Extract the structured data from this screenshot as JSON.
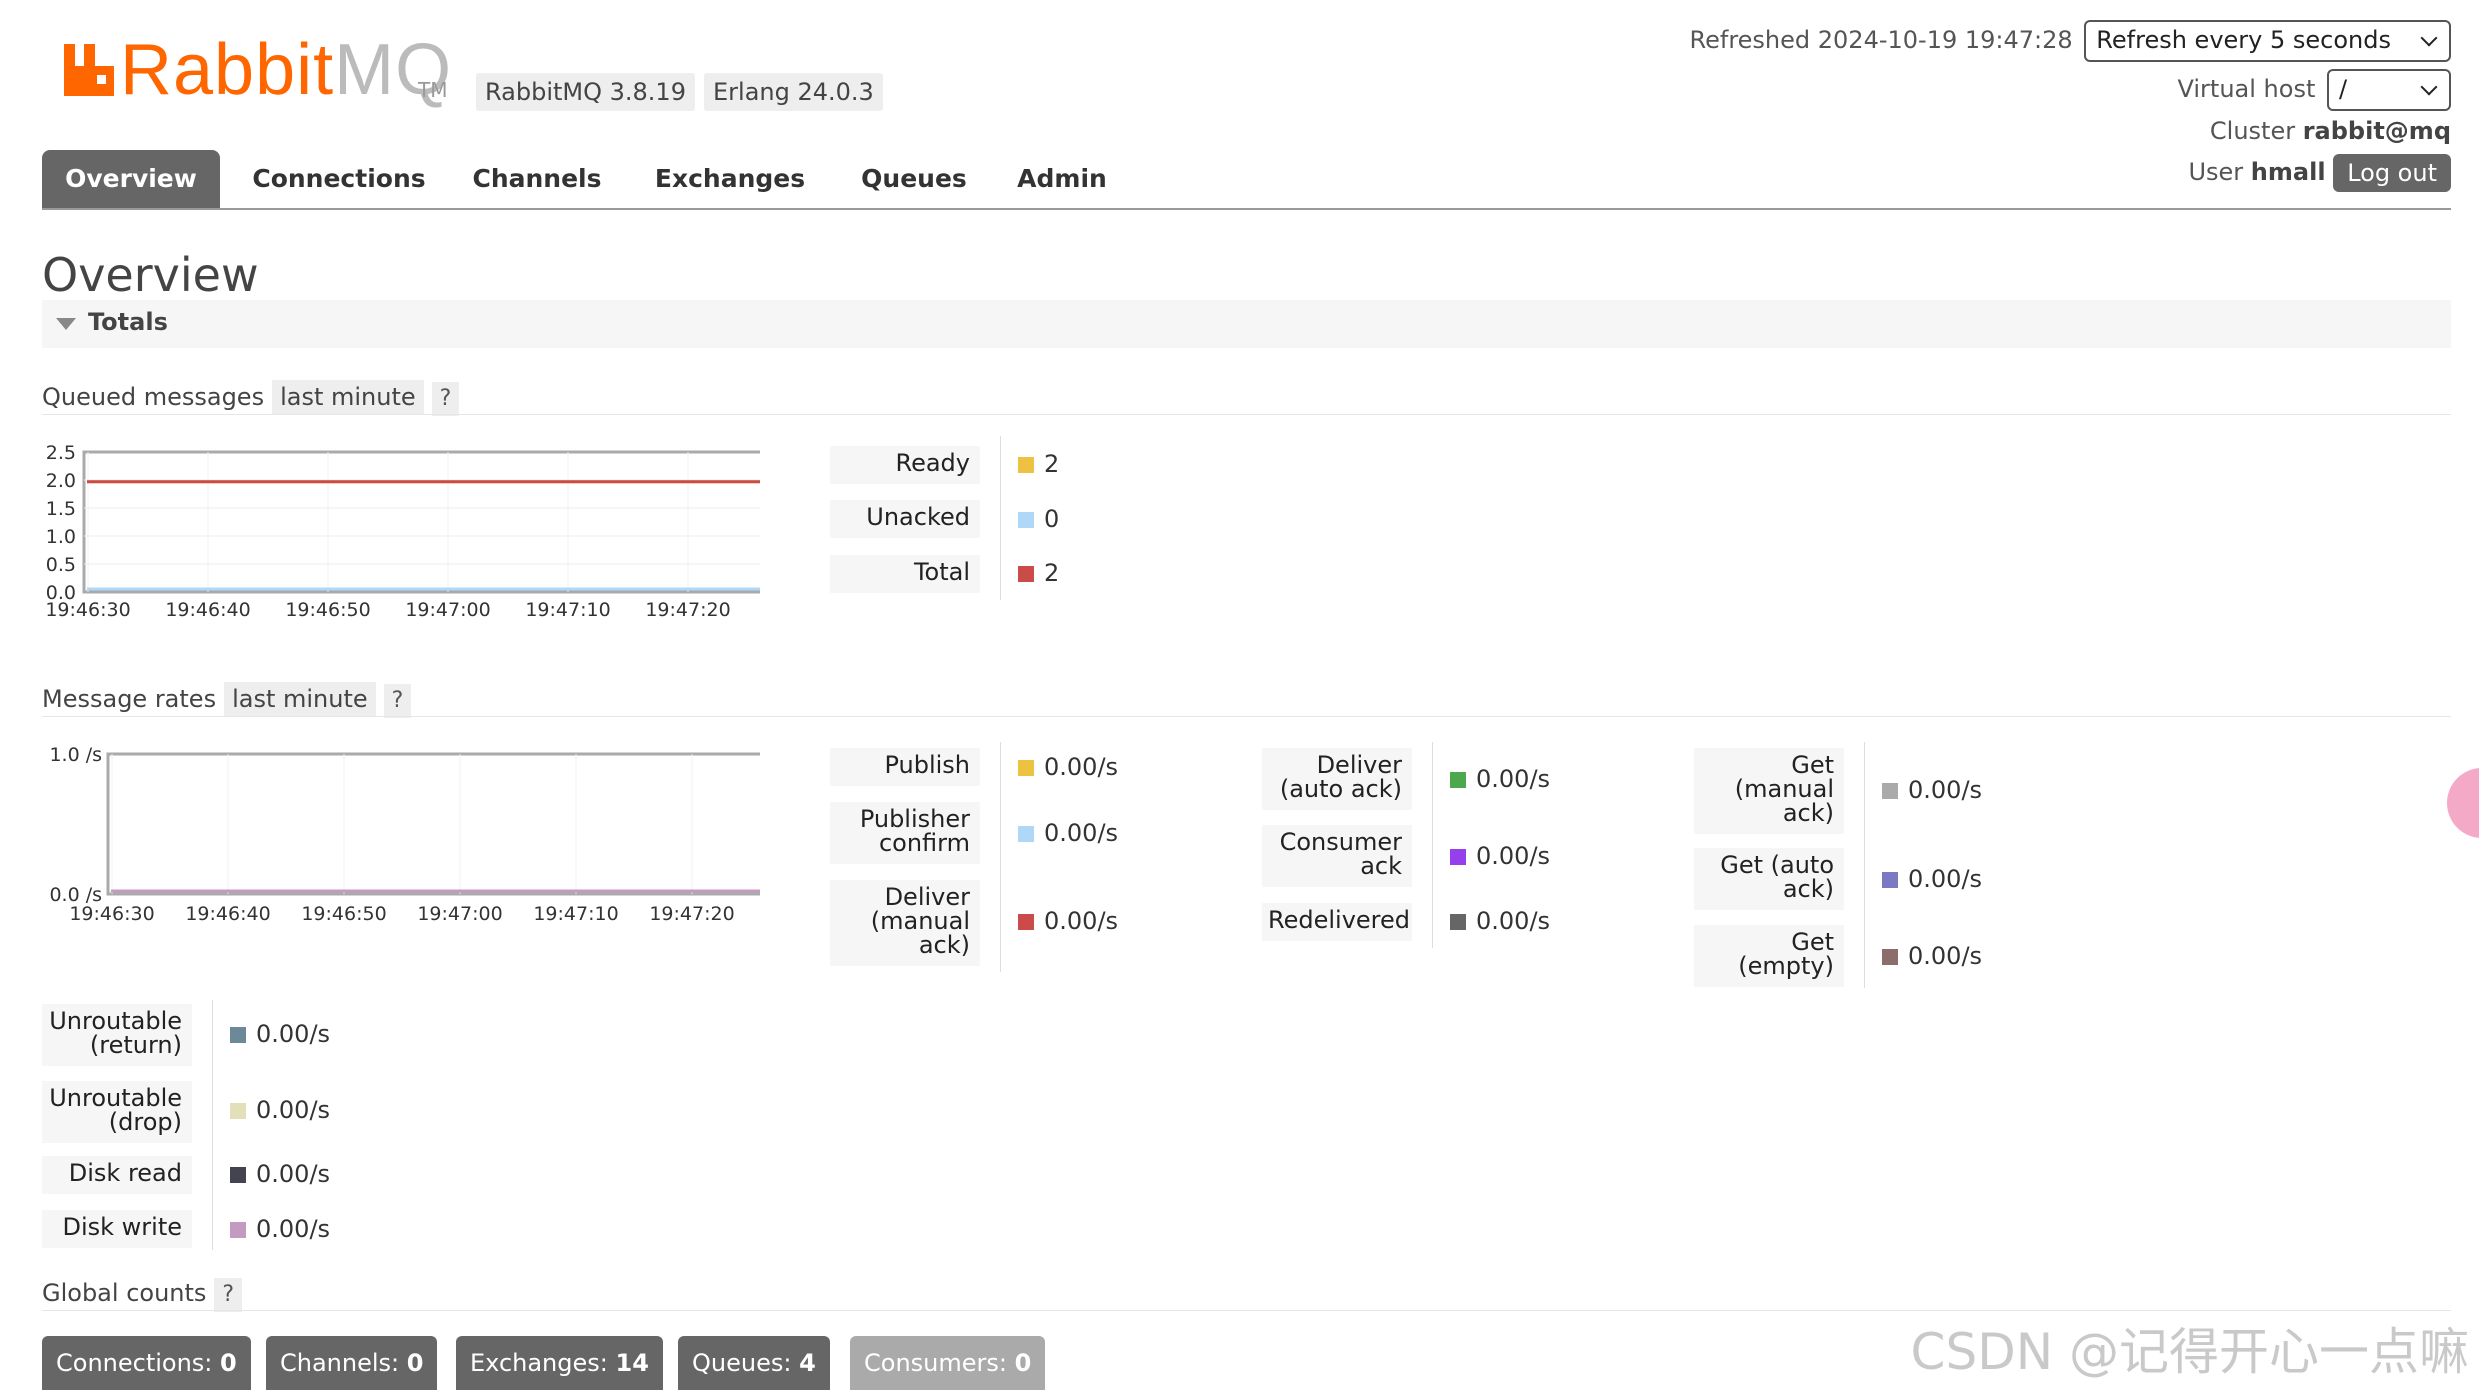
{
  "header": {
    "logo_text_rabbit": "Rabbit",
    "logo_text_mq": "MQ",
    "logo_tm": "TM",
    "rabbitmq_version": "RabbitMQ 3.8.19",
    "erlang_version": "Erlang 24.0.3",
    "refreshed_label": "Refreshed 2024-10-19 19:47:28",
    "refresh_select": "Refresh every 5 seconds",
    "virtual_host_label": "Virtual host",
    "virtual_host_value": "/",
    "cluster_label": "Cluster",
    "cluster_value": "rabbit@mq",
    "user_label": "User",
    "user_value": "hmall",
    "logout_label": "Log out"
  },
  "tabs": [
    "Overview",
    "Connections",
    "Channels",
    "Exchanges",
    "Queues",
    "Admin"
  ],
  "page_title": "Overview",
  "totals_label": "Totals",
  "queued": {
    "title": "Queued messages",
    "range": "last minute",
    "help": "?",
    "legend": [
      {
        "label": "Ready",
        "value": "2",
        "color": "#edc240"
      },
      {
        "label": "Unacked",
        "value": "0",
        "color": "#afd8f8"
      },
      {
        "label": "Total",
        "value": "2",
        "color": "#cb4b4b"
      }
    ]
  },
  "rates": {
    "title": "Message rates",
    "range": "last minute",
    "help": "?",
    "col1": [
      {
        "label": "Publish",
        "value": "0.00/s",
        "color": "#edc240"
      },
      {
        "label": "Publisher confirm",
        "value": "0.00/s",
        "color": "#afd8f8"
      },
      {
        "label": "Deliver (manual ack)",
        "value": "0.00/s",
        "color": "#cb4b4b"
      }
    ],
    "col2": [
      {
        "label": "Deliver (auto ack)",
        "value": "0.00/s",
        "color": "#4da74d"
      },
      {
        "label": "Consumer ack",
        "value": "0.00/s",
        "color": "#9440ed"
      },
      {
        "label": "Redelivered",
        "value": "0.00/s",
        "color": "#666666"
      }
    ],
    "col3": [
      {
        "label": "Get (manual ack)",
        "value": "0.00/s",
        "color": "#aaaaaa"
      },
      {
        "label": "Get (auto ack)",
        "value": "0.00/s",
        "color": "#7c79c3"
      },
      {
        "label": "Get (empty)",
        "value": "0.00/s",
        "color": "#8d6c6c"
      }
    ],
    "col4": [
      {
        "label": "Unroutable (return)",
        "value": "0.00/s",
        "color": "#6d8899"
      },
      {
        "label": "Unroutable (drop)",
        "value": "0.00/s",
        "color": "#e3e0b9"
      },
      {
        "label": "Disk read",
        "value": "0.00/s",
        "color": "#444450"
      },
      {
        "label": "Disk write",
        "value": "0.00/s",
        "color": "#c49ac1"
      }
    ]
  },
  "global_counts": {
    "title": "Global counts",
    "help": "?",
    "items": [
      {
        "label": "Connections:",
        "value": "0"
      },
      {
        "label": "Channels:",
        "value": "0"
      },
      {
        "label": "Exchanges:",
        "value": "14"
      },
      {
        "label": "Queues:",
        "value": "4"
      },
      {
        "label": "Consumers:",
        "value": "0"
      }
    ]
  },
  "watermark": "CSDN @记得开心一点嘛",
  "chart_data": [
    {
      "type": "line",
      "ylim": [
        0,
        2.5
      ],
      "yticks": [
        "2.5",
        "2.0",
        "1.5",
        "1.0",
        "0.5",
        "0.0"
      ],
      "xticks": [
        "19:46:30",
        "19:46:40",
        "19:46:50",
        "19:47:00",
        "19:47:10",
        "19:47:20"
      ],
      "series": [
        {
          "name": "Ready",
          "color": "#edc240",
          "values": [
            2,
            2,
            2,
            2,
            2,
            2,
            2
          ]
        },
        {
          "name": "Unacked",
          "color": "#afd8f8",
          "values": [
            0,
            0,
            0,
            0,
            0,
            0,
            0
          ]
        },
        {
          "name": "Total",
          "color": "#cb4b4b",
          "values": [
            2,
            2,
            2,
            2,
            2,
            2,
            2
          ]
        }
      ]
    },
    {
      "type": "line",
      "ylim": [
        0,
        1.0
      ],
      "yticks": [
        "1.0 /s",
        "0.0 /s"
      ],
      "xticks": [
        "19:46:30",
        "19:46:40",
        "19:46:50",
        "19:47:00",
        "19:47:10",
        "19:47:20"
      ],
      "series": [
        {
          "name": "Publish",
          "color": "#edc240",
          "values": [
            0,
            0,
            0,
            0,
            0,
            0,
            0
          ]
        },
        {
          "name": "Disk write",
          "color": "#c49ac1",
          "values": [
            0,
            0,
            0,
            0,
            0,
            0,
            0
          ]
        }
      ]
    }
  ]
}
